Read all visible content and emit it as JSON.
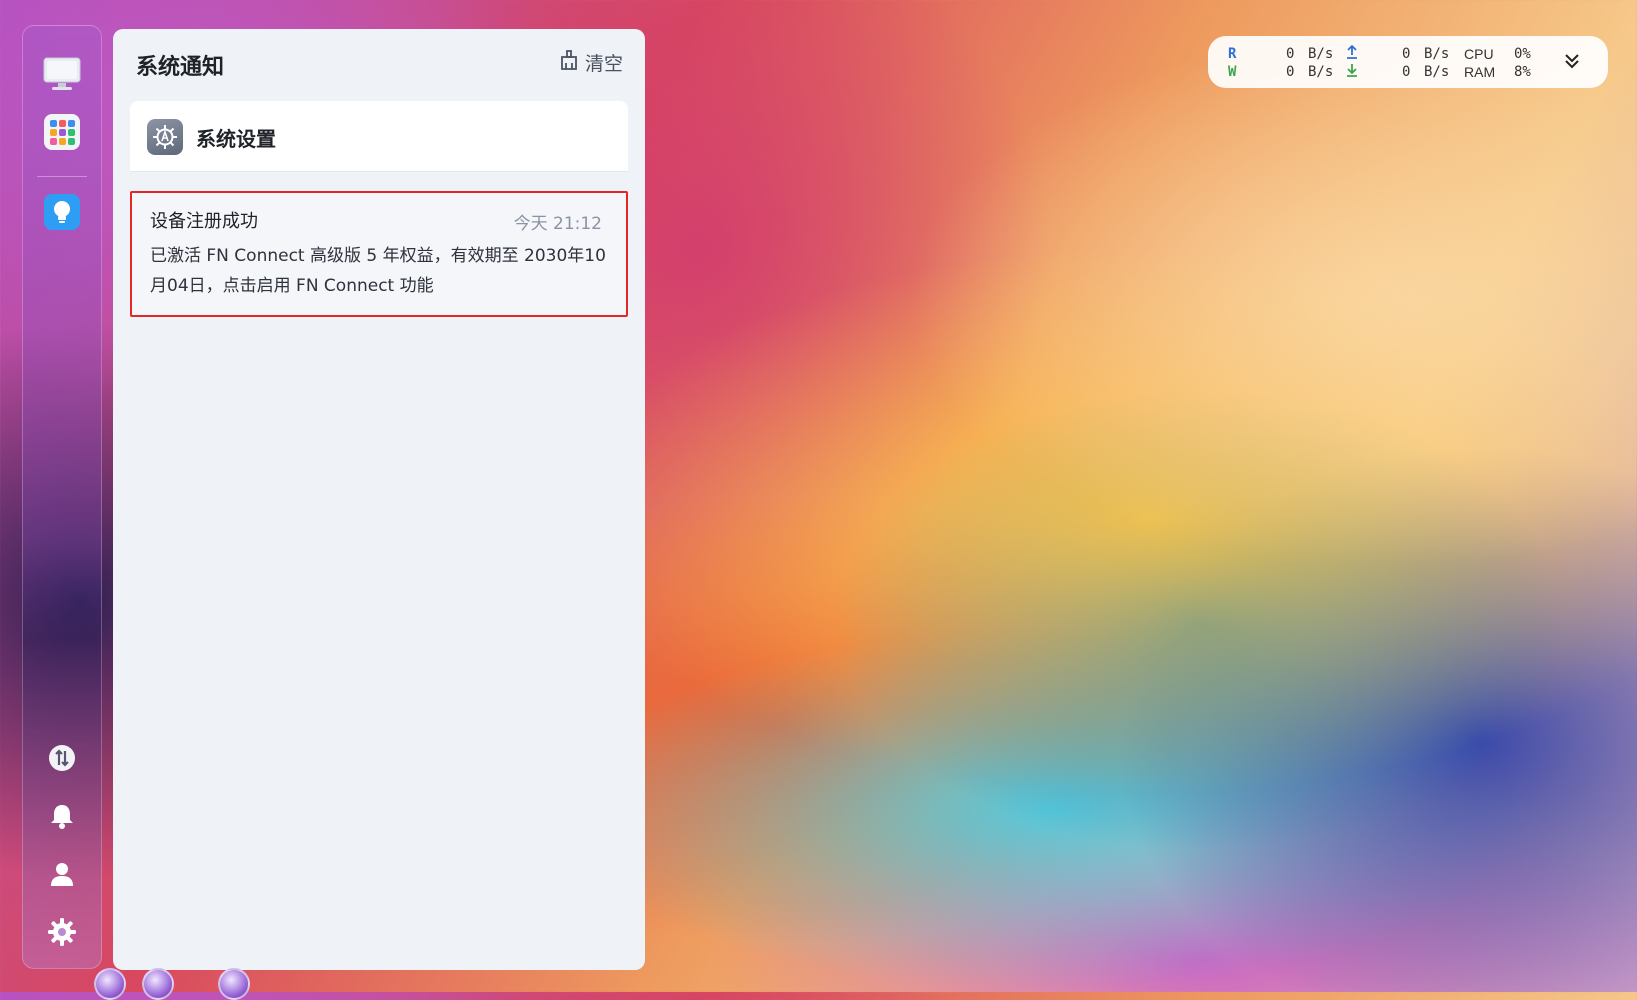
{
  "sidebar": {
    "top_items": [
      {
        "name": "desktop-icon"
      },
      {
        "name": "app-center-icon"
      },
      {
        "name": "tips-lightbulb-icon"
      }
    ],
    "bottom_items": [
      {
        "name": "transfer-icon"
      },
      {
        "name": "bell-icon"
      },
      {
        "name": "user-icon"
      },
      {
        "name": "settings-gear-icon"
      }
    ]
  },
  "panel": {
    "title": "系统通知",
    "clear_label": "清空",
    "group": {
      "title": "系统设置",
      "icon": "system-settings-icon"
    },
    "notification": {
      "title": "设备注册成功",
      "time": "今天 21:12",
      "body_line1": "已激活 FN Connect 高级版 5 年权益，有效期至 2030年10",
      "body_line2": "月04日，点击启用 FN Connect 功能"
    }
  },
  "monitor": {
    "read_label": "R",
    "write_label": "W",
    "read_value": "0",
    "write_value": "0",
    "unit": "B/s",
    "upload_value": "0",
    "download_value": "0",
    "cpu_label": "CPU",
    "ram_label": "RAM",
    "cpu_value": "0%",
    "ram_value": "8%",
    "colors": {
      "read": "#2f6fd6",
      "write": "#3aa64a",
      "upload": "#2f6fd6",
      "download": "#3aa64a"
    }
  }
}
